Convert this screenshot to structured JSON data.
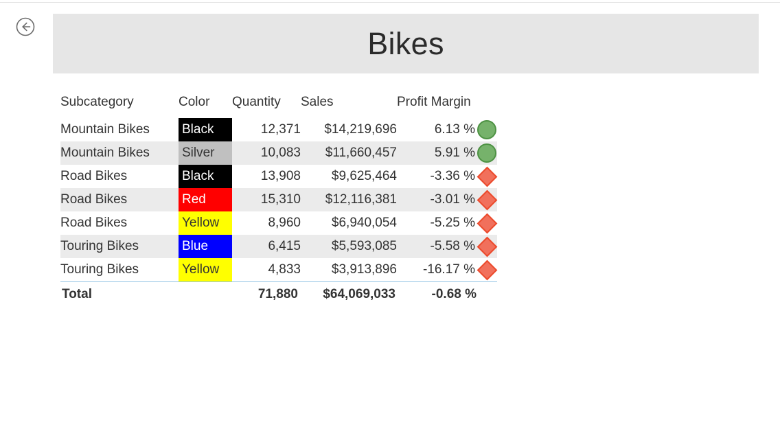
{
  "page": {
    "title": "Bikes",
    "back_icon": "back-arrow-circle-icon",
    "header_bg": "#e6e6e6"
  },
  "table": {
    "columns": [
      "Subcategory",
      "Color",
      "Quantity",
      "Sales",
      "Profit Margin"
    ],
    "rows": [
      {
        "subcategory": "Mountain Bikes",
        "color": "Black",
        "color_bg": "#000000",
        "color_fg": "#ffffff",
        "quantity": "12,371",
        "sales": "$14,219,696",
        "profit_margin": "6.13 %",
        "kpi": "circle"
      },
      {
        "subcategory": "Mountain Bikes",
        "color": "Silver",
        "color_bg": "#c0c0c0",
        "color_fg": "#333333",
        "quantity": "10,083",
        "sales": "$11,660,457",
        "profit_margin": "5.91 %",
        "kpi": "circle"
      },
      {
        "subcategory": "Road Bikes",
        "color": "Black",
        "color_bg": "#000000",
        "color_fg": "#ffffff",
        "quantity": "13,908",
        "sales": "$9,625,464",
        "profit_margin": "-3.36 %",
        "kpi": "diamond"
      },
      {
        "subcategory": "Road Bikes",
        "color": "Red",
        "color_bg": "#ff0000",
        "color_fg": "#ffffff",
        "quantity": "15,310",
        "sales": "$12,116,381",
        "profit_margin": "-3.01 %",
        "kpi": "diamond"
      },
      {
        "subcategory": "Road Bikes",
        "color": "Yellow",
        "color_bg": "#ffff00",
        "color_fg": "#333333",
        "quantity": "8,960",
        "sales": "$6,940,054",
        "profit_margin": "-5.25 %",
        "kpi": "diamond"
      },
      {
        "subcategory": "Touring Bikes",
        "color": "Blue",
        "color_bg": "#0000ff",
        "color_fg": "#ffffff",
        "quantity": "6,415",
        "sales": "$5,593,085",
        "profit_margin": "-5.58 %",
        "kpi": "diamond"
      },
      {
        "subcategory": "Touring Bikes",
        "color": "Yellow",
        "color_bg": "#ffff00",
        "color_fg": "#333333",
        "quantity": "4,833",
        "sales": "$3,913,896",
        "profit_margin": "-16.17 %",
        "kpi": "diamond"
      }
    ],
    "total": {
      "label": "Total",
      "color": "",
      "quantity": "71,880",
      "sales": "$64,069,033",
      "profit_margin": "-0.68 %"
    },
    "kpi_colors": {
      "good_fill": "#76b26b",
      "good_border": "#4d9243",
      "bad_fill": "#f1705c",
      "bad_border": "#ec4a2c"
    },
    "band_color": "#ebebeb",
    "rule_color": "#8fc1e3"
  }
}
